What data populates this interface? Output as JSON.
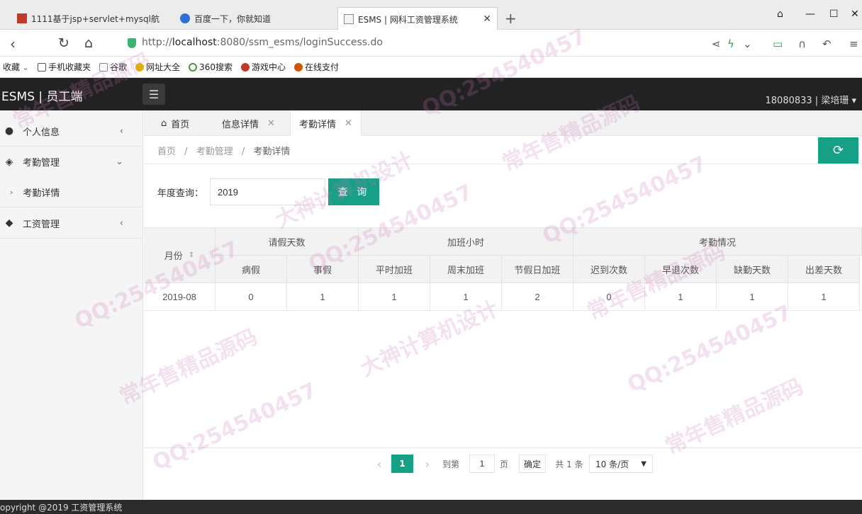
{
  "browser": {
    "tabs": [
      {
        "title": "1111基于jsp+servlet+mysql航"
      },
      {
        "title": "百度一下，你就知道"
      },
      {
        "title": "ESMS | 网科工资管理系统"
      }
    ],
    "url_prefix": "http://",
    "url_host": "localhost",
    "url_rest": ":8080/ssm_esms/loginSuccess.do",
    "bookmarks": [
      "收藏",
      "手机收藏夹",
      "谷歌",
      "网址大全",
      "360搜索",
      "游戏中心",
      "在线支付"
    ]
  },
  "app": {
    "logo": "ESMS | 员工端",
    "user": "18080833 | 梁培珊",
    "accent_color": "#16a085"
  },
  "sidebar": {
    "items": [
      {
        "label": "个人信息",
        "icon": "user-icon"
      },
      {
        "label": "考勤管理",
        "icon": "layers-icon"
      },
      {
        "label": "考勤详情",
        "icon": "chevron-right-icon"
      },
      {
        "label": "工资管理",
        "icon": "tag-icon"
      }
    ]
  },
  "page_tabs": [
    {
      "label": "首页"
    },
    {
      "label": "信息详情"
    },
    {
      "label": "考勤详情"
    }
  ],
  "breadcrumb": [
    "首页",
    "考勤管理",
    "考勤详情"
  ],
  "breadcrumb_sep": "/",
  "search": {
    "label": "年度查询：",
    "value": "2019",
    "button": "查 询"
  },
  "table": {
    "month_header": "月份",
    "groups": [
      "请假天数",
      "加班小时",
      "考勤情况"
    ],
    "columns": [
      "病假",
      "事假",
      "平时加班",
      "周末加班",
      "节假日加班",
      "迟到次数",
      "早退次数",
      "缺勤天数",
      "出差天数"
    ],
    "rows": [
      {
        "month": "2019-08",
        "values": [
          "0",
          "1",
          "1",
          "1",
          "2",
          "0",
          "1",
          "1",
          "1"
        ]
      }
    ]
  },
  "pager": {
    "current": "1",
    "goto_label": "到第",
    "goto_value": "1",
    "page_unit": "页",
    "confirm": "确定",
    "total": "共 1 条",
    "page_size": "10 条/页"
  },
  "footer": "opyright @2019 工资管理系统",
  "watermarks": [
    "QQ:254540457",
    "常年售精品源码",
    "大神计算机设计"
  ]
}
